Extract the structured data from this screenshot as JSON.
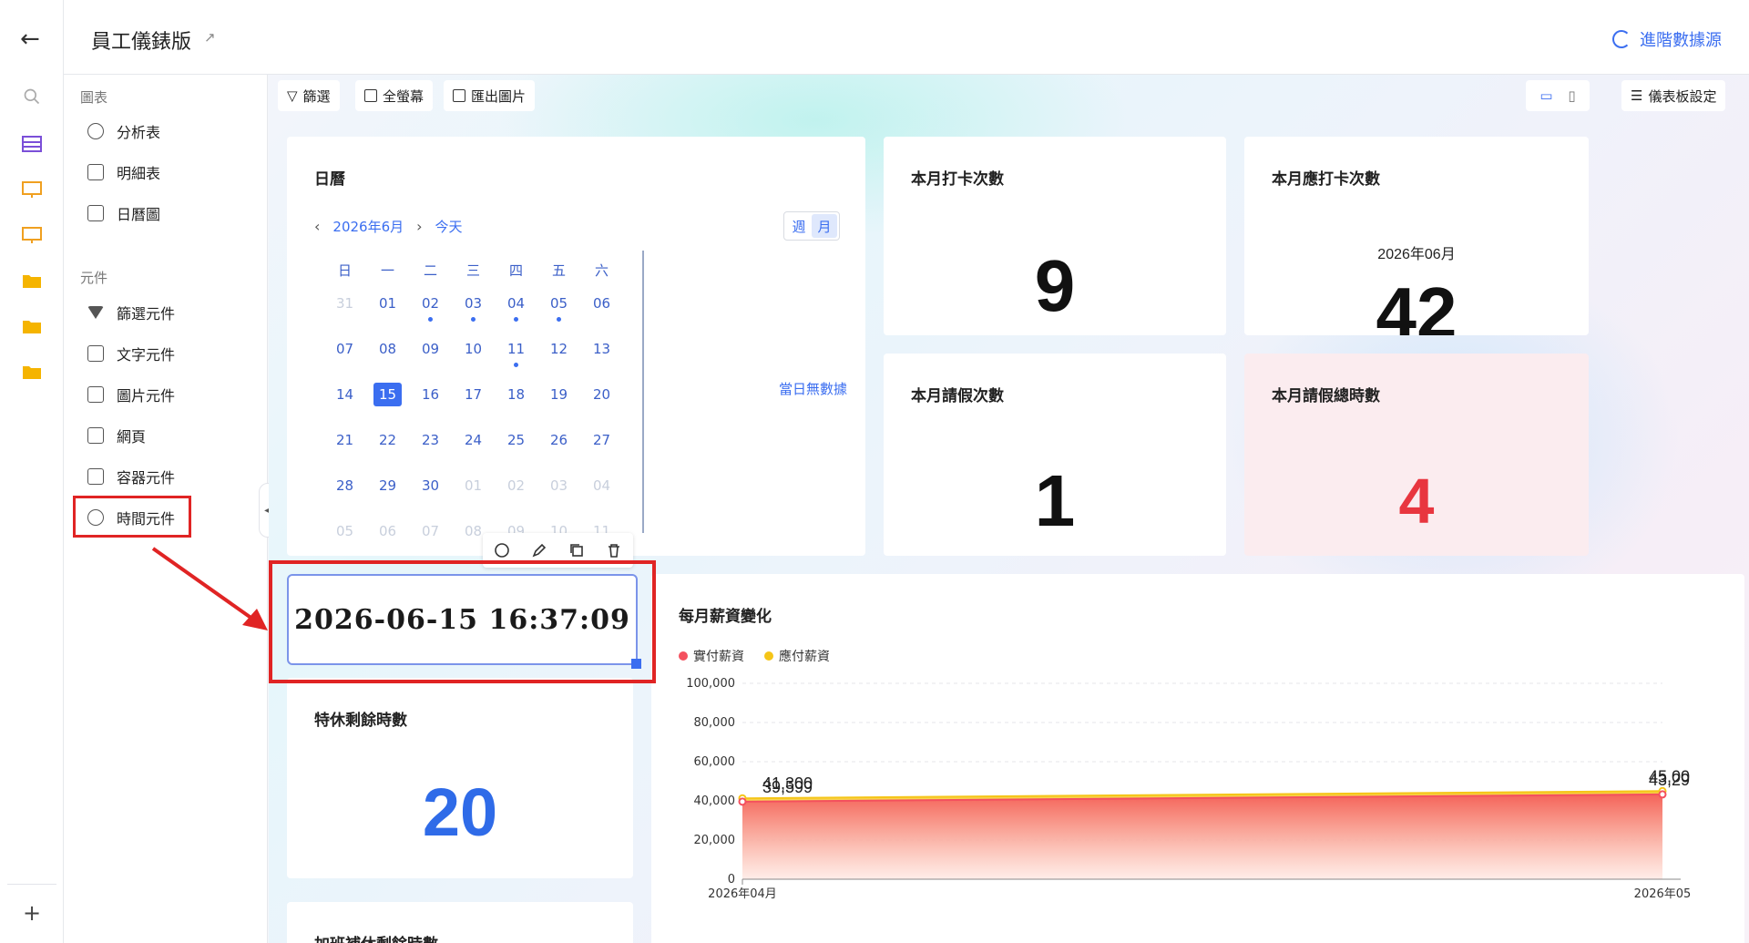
{
  "header": {
    "title": "員工儀錶版",
    "advanced_source_label": "進階數據源"
  },
  "left_panel": {
    "section_charts": "圖表",
    "chart_items": [
      {
        "label": "分析表",
        "icon": "pie-chart-icon"
      },
      {
        "label": "明細表",
        "icon": "table-icon"
      },
      {
        "label": "日曆圖",
        "icon": "calendar-icon"
      }
    ],
    "section_components": "元件",
    "component_items": [
      {
        "label": "篩選元件",
        "icon": "filter-icon"
      },
      {
        "label": "文字元件",
        "icon": "text-icon"
      },
      {
        "label": "圖片元件",
        "icon": "image-icon"
      },
      {
        "label": "網頁",
        "icon": "webpage-icon"
      },
      {
        "label": "容器元件",
        "icon": "container-icon"
      },
      {
        "label": "時間元件",
        "icon": "clock-icon"
      }
    ]
  },
  "toolbar": {
    "filter_label": "篩選",
    "fullscreen_label": "全螢幕",
    "export_label": "匯出圖片",
    "settings_label": "儀表板設定"
  },
  "calendar": {
    "title": "日曆",
    "month_label": "2026年6月",
    "today_label": "今天",
    "view_week": "週",
    "view_month": "月",
    "weekdays": [
      "日",
      "一",
      "二",
      "三",
      "四",
      "五",
      "六"
    ],
    "weeks": [
      [
        "31",
        "01",
        "02",
        "03",
        "04",
        "05",
        "06"
      ],
      [
        "07",
        "08",
        "09",
        "10",
        "11",
        "12",
        "13"
      ],
      [
        "14",
        "15",
        "16",
        "17",
        "18",
        "19",
        "20"
      ],
      [
        "21",
        "22",
        "23",
        "24",
        "25",
        "26",
        "27"
      ],
      [
        "28",
        "29",
        "30",
        "01",
        "02",
        "03",
        "04"
      ],
      [
        "05",
        "06",
        "07",
        "08",
        "09",
        "10",
        "11"
      ]
    ],
    "selected_day": "15",
    "days_with_events": [
      "02",
      "03",
      "04",
      "05",
      "11"
    ],
    "no_data_text": "當日無數據"
  },
  "kpis": {
    "checkins": {
      "title": "本月打卡次數",
      "value": "9"
    },
    "expected_checkins": {
      "title": "本月應打卡次數",
      "subtitle": "2026年06月",
      "value": "42"
    },
    "leave_count": {
      "title": "本月請假次數",
      "value": "1"
    },
    "leave_hours": {
      "title": "本月請假總時數",
      "value": "4"
    },
    "annual_leave": {
      "title": "特休剩餘時數",
      "value": "20"
    },
    "overtime_comp": {
      "title": "加班補休剩餘時數"
    }
  },
  "time_widget": {
    "value": "2026-06-15 16:37:09"
  },
  "colors": {
    "accent": "#3b6ef0",
    "highlight": "#e02424",
    "actual_pay": "#f4505e",
    "payable": "#f5c518",
    "leave_hours_num": "#e8363f",
    "annual_num": "#2f6be8"
  },
  "chart_data": {
    "type": "area",
    "title": "每月薪資變化",
    "x": [
      "2026年04月",
      "2026年05"
    ],
    "ylim": [
      0,
      100000
    ],
    "yticks": [
      "100,000",
      "80,000",
      "60,000",
      "40,000",
      "20,000",
      "0"
    ],
    "series": [
      {
        "name": "實付薪資",
        "values": [
          39599,
          43299
        ],
        "labels": [
          "39,599",
          "43,29"
        ]
      },
      {
        "name": "應付薪資",
        "values": [
          41300,
          45000
        ],
        "labels": [
          "41,300",
          "45,00"
        ]
      }
    ],
    "legend": "top-left",
    "grid": true
  }
}
